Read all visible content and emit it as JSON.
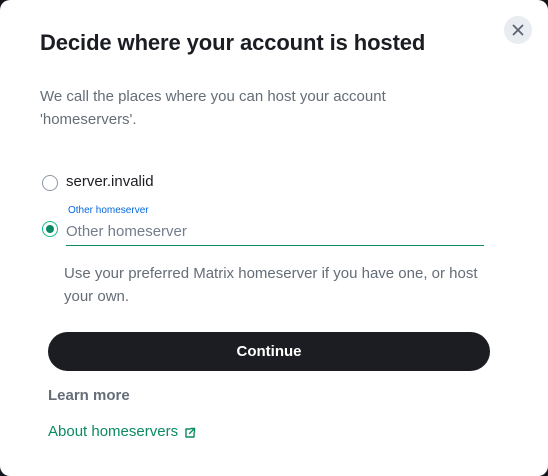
{
  "dialog": {
    "title": "Decide where your account is hosted",
    "description": "We call the places where you can host your account 'homeservers'.",
    "close_icon": "close-icon"
  },
  "options": [
    {
      "label": "server.invalid",
      "selected": false
    }
  ],
  "other_server": {
    "selected": true,
    "field_label": "Other homeserver",
    "placeholder": "Other homeserver",
    "value": ""
  },
  "helper_text": "Use your preferred Matrix homeserver if you have one, or host your own.",
  "continue_label": "Continue",
  "learn_more": {
    "heading": "Learn more",
    "link_label": "About homeservers",
    "link_icon": "external-link-icon"
  },
  "colors": {
    "accent": "#0b8a64",
    "focus_blue": "#0467dd",
    "primary_button": "#1b1d22",
    "text_secondary": "#656d77"
  }
}
